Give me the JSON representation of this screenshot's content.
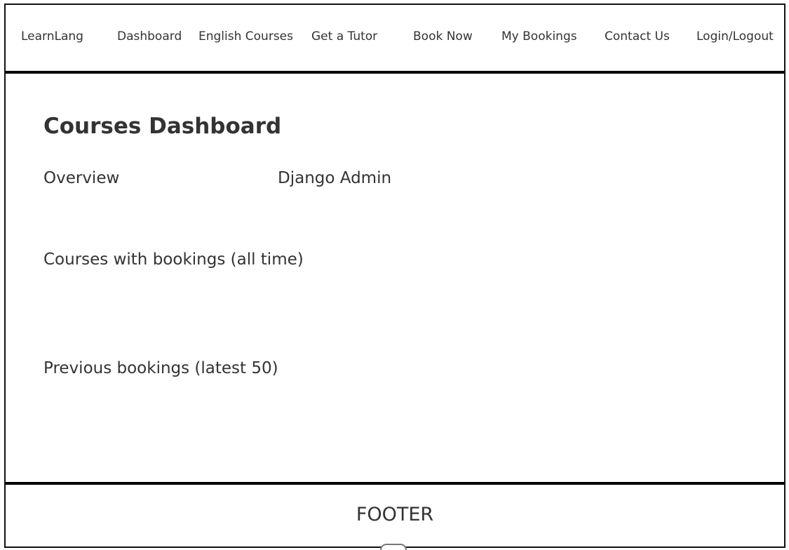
{
  "navbar": {
    "brand": "LearnLang",
    "items": [
      {
        "label": "Dashboard"
      },
      {
        "label": "English Courses"
      },
      {
        "label": "Get a Tutor"
      },
      {
        "label": "Book Now"
      },
      {
        "label": "My Bookings"
      },
      {
        "label": "Contact Us"
      },
      {
        "label": "Login/Logout"
      }
    ]
  },
  "main": {
    "title": "Courses Dashboard",
    "tabs": [
      {
        "label": "Overview"
      },
      {
        "label": "Django Admin"
      }
    ],
    "sections": [
      {
        "heading": "Courses with bookings (all time)"
      },
      {
        "heading": "Previous bookings (latest 50)"
      }
    ]
  },
  "footer": {
    "text": "FOOTER"
  }
}
